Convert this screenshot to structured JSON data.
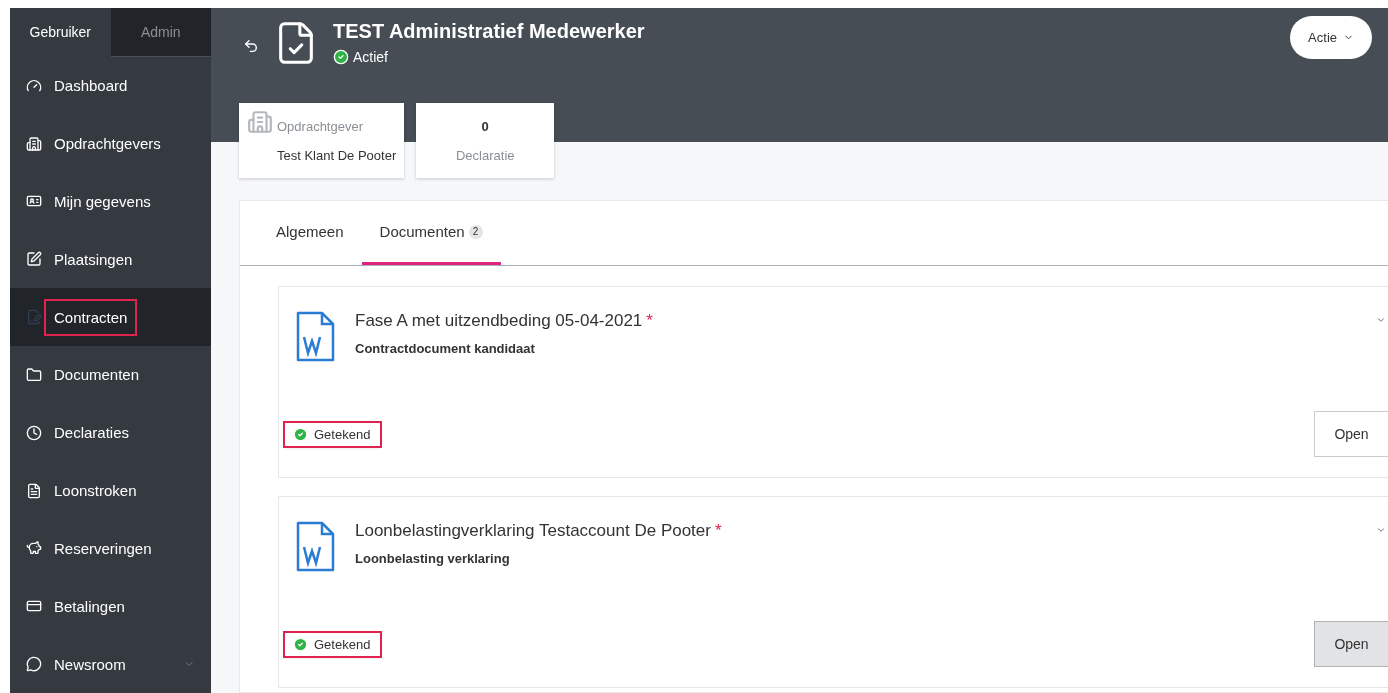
{
  "sidebar": {
    "tabs": [
      {
        "label": "Gebruiker",
        "selected": true
      },
      {
        "label": "Admin",
        "selected": false
      }
    ],
    "items": [
      {
        "kind": "dashboard",
        "label": "Dashboard",
        "selected": false,
        "highlighted": false
      },
      {
        "kind": "clients",
        "label": "Opdrachtgevers",
        "selected": false,
        "highlighted": false
      },
      {
        "kind": "profile",
        "label": "Mijn gegevens",
        "selected": false,
        "highlighted": false
      },
      {
        "kind": "placements",
        "label": "Plaatsingen",
        "selected": false,
        "highlighted": false
      },
      {
        "kind": "contracts",
        "label": "Contracten",
        "selected": true,
        "highlighted": true
      },
      {
        "kind": "documents",
        "label": "Documenten",
        "selected": false,
        "highlighted": false
      },
      {
        "kind": "claims",
        "label": "Declaraties",
        "selected": false,
        "highlighted": false
      },
      {
        "kind": "payslips",
        "label": "Loonstroken",
        "selected": false,
        "highlighted": false
      },
      {
        "kind": "reservations",
        "label": "Reserveringen",
        "selected": false,
        "highlighted": false
      },
      {
        "kind": "payments",
        "label": "Betalingen",
        "selected": false,
        "highlighted": false
      },
      {
        "kind": "newsroom",
        "label": "Newsroom",
        "selected": false,
        "highlighted": false,
        "expandable": true
      }
    ]
  },
  "header": {
    "title": "TEST Administratief Medewerker",
    "status": "Actief",
    "action": "Actie"
  },
  "info_cards": [
    {
      "kind": "client",
      "label": "Opdrachtgever",
      "value": "Test Klant De Pooter"
    },
    {
      "kind": "count",
      "value": "0",
      "label": "Declaratie"
    }
  ],
  "tabs": [
    {
      "label": "Algemeen",
      "selected": false
    },
    {
      "label": "Documenten",
      "badge": "2",
      "selected": true
    }
  ],
  "documents": [
    {
      "title": "Fase A met uitzendbeding 05-04-2021",
      "required_mark": "*",
      "subtitle": "Contractdocument kandidaat",
      "status": "Getekend",
      "highlighted": true,
      "button": "Open",
      "hovered": false
    },
    {
      "title": "Loonbelastingverklaring Testaccount De Pooter",
      "required_mark": "*",
      "subtitle": "Loonbelasting verklaring",
      "status": "Getekend",
      "highlighted": true,
      "button": "Open",
      "hovered": true
    }
  ]
}
